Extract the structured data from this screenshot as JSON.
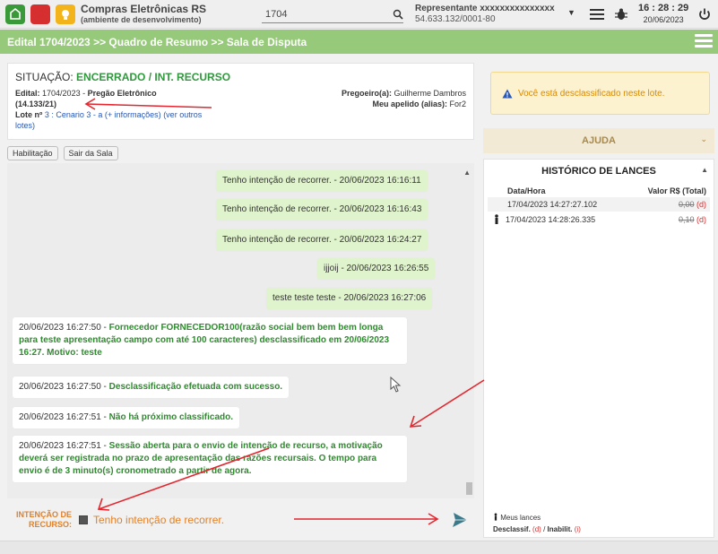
{
  "header": {
    "app_title": "Compras Eletrônicas RS",
    "app_subtitle": "(ambiente de desenvolvimento)",
    "search_value": "1704",
    "representative": "Representante xxxxxxxxxxxxxxx",
    "cnpj": "54.633.132/0001-80",
    "time": "16 : 28 : 29",
    "date": "20/06/2023"
  },
  "banner": {
    "breadcrumb": "Edital 1704/2023 >> Quadro de Resumo >> Sala de Disputa"
  },
  "situation": {
    "label": "SITUAÇÃO:",
    "status": "ENCERRADO / INT. RECURSO",
    "edital_label": "Edital:",
    "edital_value": "1704/2023 -",
    "modality": "Pregão Eletrônico",
    "process": "(14.133/21)",
    "lote_label": "Lote nº",
    "lote_number": "3",
    "lote_rest": ": Cenario 3 - a",
    "more_info": "(+ informações)",
    "other_lots": "(ver outros lotes)",
    "pregoeiro_label": "Pregoeiro(a):",
    "pregoeiro_name": "Guilherme Dambros",
    "alias_label": "Meu apelido (alias):",
    "alias_value": "For2"
  },
  "buttons": {
    "habilitacao": "Habilitação",
    "sair": "Sair da Sala"
  },
  "chat": {
    "mine": [
      "Tenho intenção de recorrer. - 20/06/2023 16:16:11",
      "Tenho intenção de recorrer. - 20/06/2023 16:16:43",
      "Tenho intenção de recorrer. - 20/06/2023 16:24:27",
      "ijjoij - 20/06/2023 16:26:55",
      "teste teste teste - 20/06/2023 16:27:06"
    ],
    "system": [
      {
        "ts": "20/06/2023 16:27:50 -",
        "text": "Fornecedor FORNECEDOR100(razão social bem bem bem longa para teste apresentação campo com até 100 caracteres) desclassificado em 20/06/2023 16:27. Motivo: teste"
      },
      {
        "ts": "20/06/2023 16:27:50 -",
        "text": "Desclassificação efetuada com sucesso."
      },
      {
        "ts": "20/06/2023 16:27:51 -",
        "text": "Não há próximo classificado."
      },
      {
        "ts": "20/06/2023 16:27:51 -",
        "text": "Sessão aberta para o envio de intenção de recurso, a motivação deverá ser registrada no prazo de apresentação das razões recursais. O tempo para envio é de 3 minuto(s) cronometrado a partir de agora."
      }
    ]
  },
  "intent": {
    "label_line1": "INTENÇÃO DE",
    "label_line2": "RECURSO:",
    "text": "Tenho intenção de recorrer.",
    "checked": true
  },
  "warning": {
    "text": "Você está desclassificado neste lote."
  },
  "help": {
    "title": "AJUDA"
  },
  "history": {
    "title": "HISTÓRICO DE LANCES",
    "col_date": "Data/Hora",
    "col_value": "Valor R$ (Total)",
    "rows": [
      {
        "datetime": "17/04/2023 14:27:27.102",
        "value": "0,00",
        "flag": "(d)"
      },
      {
        "datetime": "17/04/2023 14:28:26.335",
        "value": "0,10",
        "flag": "(d)"
      }
    ],
    "legend_mine": "Meus lances",
    "legend_disq": "Desclassif.",
    "legend_disq_flag": "(d)",
    "legend_sep": "/",
    "legend_inab": "Inabilit.",
    "legend_inab_flag": "(i)"
  },
  "colors": {
    "banner": "#96c97a",
    "status_green": "#2e9a3c",
    "intent_orange": "#e0812a",
    "annotation_red": "#e3262f"
  }
}
